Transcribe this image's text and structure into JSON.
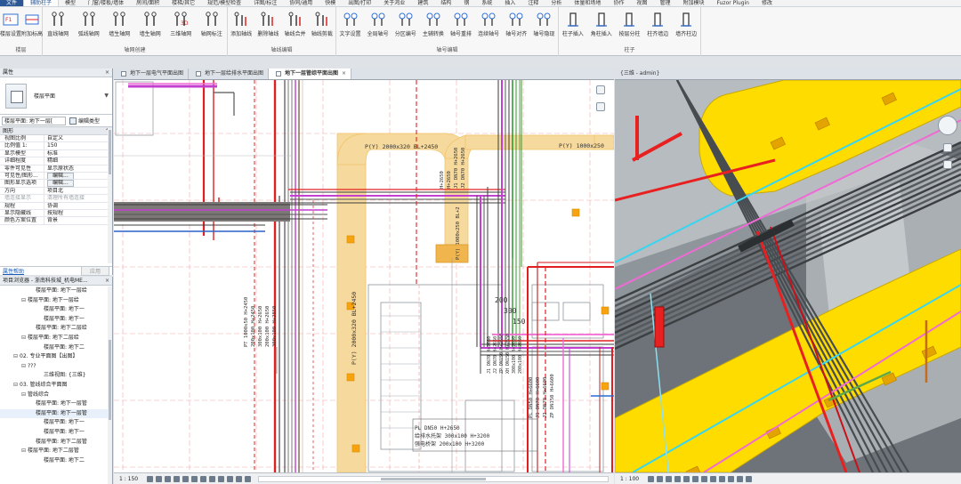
{
  "menu": [
    "文件",
    "辅助柱子",
    "模型",
    "门窗/楼板/墙体",
    "房间/面积",
    "楼梯/其它",
    "规范/模型检查",
    "详图/标注",
    "协同/通用",
    "快模",
    "出图/打印",
    "关于鸿业",
    "建筑",
    "结构",
    "钢",
    "系统",
    "插入",
    "注释",
    "分析",
    "体量和场地",
    "协作",
    "视图",
    "管理",
    "附加模块",
    "Fuzor Plugin",
    "修改"
  ],
  "ribbon": {
    "groups": [
      {
        "name": "楼层",
        "buttons": [
          "楼层设置",
          "附加标高"
        ]
      },
      {
        "name": "轴网创建",
        "buttons": [
          "直线轴网",
          "弧线轴网",
          "墙生轴网",
          "墙生轴网",
          "三维轴网",
          "轴网标注"
        ]
      },
      {
        "name": "轴线编辑",
        "buttons": [
          "添加轴线",
          "删除轴线",
          "轴线合并",
          "轴线剪裁"
        ]
      },
      {
        "name": "轴号编辑",
        "buttons": [
          "文字设置",
          "全局轴号",
          "分区编号",
          "主辅转换",
          "轴号重排",
          "连续轴号",
          "轴号对齐",
          "轴号隐现"
        ]
      },
      {
        "name": "柱子",
        "buttons": [
          "柱子插入",
          "角柱插入",
          "按层分柱",
          "柱齐墙边",
          "墙齐柱边"
        ]
      }
    ]
  },
  "properties": {
    "title": "属性",
    "close": "×",
    "type_name": "楼层平面",
    "instance_selector": "楼层平面: 地下一层[",
    "edit_type": "编辑类型",
    "category": "图形",
    "rows": [
      {
        "k": "视图比例",
        "v": "自定义"
      },
      {
        "k": "比例值 1:",
        "v": "150"
      },
      {
        "k": "显示模型",
        "v": "标准"
      },
      {
        "k": "详细程度",
        "v": "精细"
      },
      {
        "k": "零件可见性",
        "v": "显示原状态"
      },
      {
        "k": "可见性/图形...",
        "v": "编辑..."
      },
      {
        "k": "图形显示选项",
        "v": "编辑..."
      },
      {
        "k": "方向",
        "v": "项目北"
      },
      {
        "k": "墙连接显示",
        "v": "清理所有墙连接"
      },
      {
        "k": "规程",
        "v": "协调"
      },
      {
        "k": "显示隐藏线",
        "v": "按规程"
      },
      {
        "k": "颜色方案位置",
        "v": "背景"
      }
    ],
    "help": "属性帮助",
    "apply": "应用"
  },
  "browser": {
    "title": "项目浏览器 - 浙南科技城_机电ME...",
    "nodes": [
      {
        "t": "楼层平面: 地下一层给",
        "lvl": 3,
        "tg": ""
      },
      {
        "t": "楼层平面: 地下一层给",
        "lvl": 2,
        "tg": "⊟"
      },
      {
        "t": "楼层平面: 地下一",
        "lvl": 4,
        "tg": ""
      },
      {
        "t": "楼层平面: 地下一",
        "lvl": 4,
        "tg": ""
      },
      {
        "t": "楼层平面: 地下二层给",
        "lvl": 3,
        "tg": ""
      },
      {
        "t": "楼层平面: 地下二层给",
        "lvl": 2,
        "tg": "⊟"
      },
      {
        "t": "楼层平面: 地下二",
        "lvl": 4,
        "tg": ""
      },
      {
        "t": "02. 专业平面图【出图】",
        "lvl": 1,
        "tg": "⊟"
      },
      {
        "t": "???",
        "lvl": 2,
        "tg": "⊟"
      },
      {
        "t": "三维视图: {三维}",
        "lvl": 4,
        "tg": ""
      },
      {
        "t": "03. 管线综合平面图",
        "lvl": 1,
        "tg": "⊟"
      },
      {
        "t": "管线综合",
        "lvl": 2,
        "tg": "⊟"
      },
      {
        "t": "楼层平面: 地下一层管",
        "lvl": 3,
        "tg": ""
      },
      {
        "t": "楼层平面: 地下一层管",
        "lvl": 3,
        "tg": "",
        "sel": true
      },
      {
        "t": "楼层平面: 地下一",
        "lvl": 4,
        "tg": ""
      },
      {
        "t": "楼层平面: 地下一",
        "lvl": 4,
        "tg": ""
      },
      {
        "t": "楼层平面: 地下二层管",
        "lvl": 3,
        "tg": ""
      },
      {
        "t": "楼层平面: 地下二层管",
        "lvl": 2,
        "tg": "⊟"
      },
      {
        "t": "楼层平面: 地下二",
        "lvl": 4,
        "tg": ""
      }
    ]
  },
  "tabs": [
    {
      "label": "地下一层电气平面出图",
      "active": false
    },
    {
      "label": "地下一层给排水平面出图",
      "active": false
    },
    {
      "label": "地下一层管综平面出图",
      "active": true
    }
  ],
  "tab_close": "×",
  "view3d_title": "{三维 - admin}",
  "plan_labels": {
    "duct_top": "P(Y) 2000x320 BL+2450",
    "duct_right": "P(Y) 1000x250",
    "duct_vert": "P(Y) 2000x320 BL+2450",
    "duct_small": "P(Y) 1000x250 BL+2",
    "stack_left": [
      "PT 1000x50 H+2450",
      "200x100 H+2450",
      "300x100 H+2650",
      "200x100 H+2650",
      "300x100 H+2850"
    ],
    "stack_mid": [
      "H+2650",
      "H+2650",
      "J1 DN70 H+2650",
      "J2 DN70 H+2650"
    ],
    "stack_right": [
      "J1 DN70 H+2650",
      "J2 DN70 H+2650",
      "ZP DN150 H+2650",
      "XH DN150 H+2650",
      "300x100 H+2650",
      "200x100 H+2650"
    ],
    "bottom_block": [
      "PL DN50 H+2650",
      "给排水托架 300x100 H+3200",
      "强电桥架 200x100 H+3200"
    ],
    "right_stack": [
      "PL DN50 H+6600",
      "J1 DN70 H+6600",
      "J2 DN70 H+6600",
      "ZP DN150 H+6600"
    ],
    "mid_box": [
      "200",
      "300",
      "150"
    ]
  },
  "status_left_scale": "1 : 150",
  "status_right_scale": "1 : 100",
  "colors": {
    "duct": "#f2c46b",
    "duct_fill": "#f6d99d",
    "fire_red": "#e02020",
    "magenta": "#c33fd0",
    "pink": "#f06ad6",
    "green": "#2a9d2a",
    "blue": "#2b6cd1",
    "yellow3d": "#ffdc00",
    "cyan3d": "#37d5f0"
  },
  "icons": [
    "level-settings-icon",
    "grid-icon",
    "axis-edit-icon",
    "axis-number-icon",
    "column-icon",
    "view-tab-icon",
    "close-icon",
    "nav-wheel-icon",
    "zoom-icon"
  ]
}
